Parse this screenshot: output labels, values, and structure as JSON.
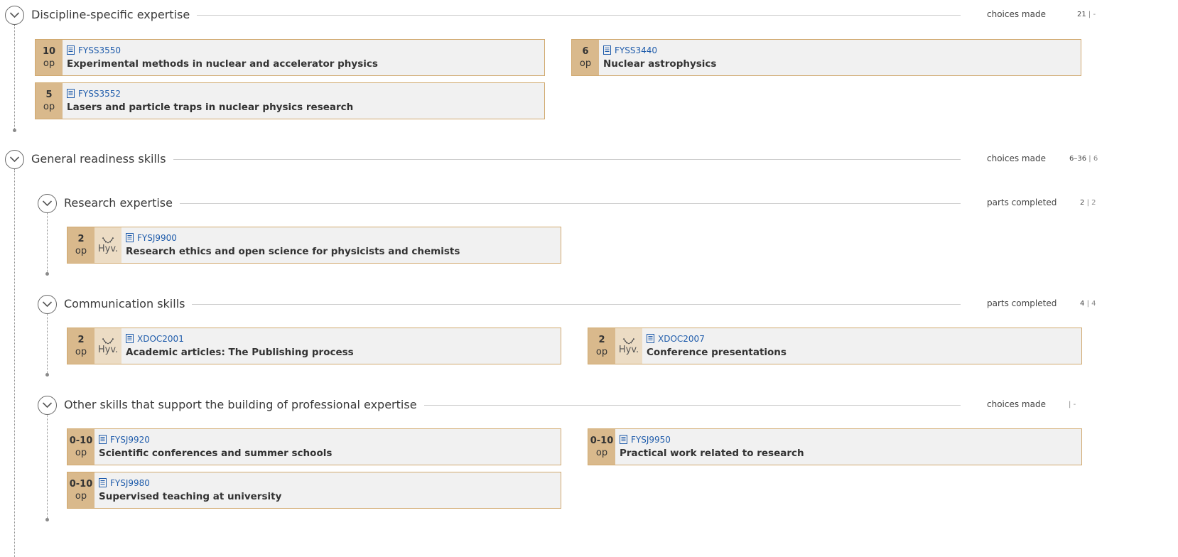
{
  "sections": {
    "discipline": {
      "title": "Discipline-specific expertise",
      "status": "choices made",
      "count": "21",
      "limit": "-"
    },
    "general": {
      "title": "General readiness skills",
      "status": "choices made",
      "count": "6–36",
      "limit": "6"
    },
    "research": {
      "title": "Research expertise",
      "status": "parts completed",
      "count": "2",
      "limit": "2"
    },
    "communication": {
      "title": "Communication skills",
      "status": "parts completed",
      "count": "4",
      "limit": "4"
    },
    "other": {
      "title": "Other skills that support the building of professional expertise",
      "status": "choices made",
      "count": "",
      "limit": "-"
    }
  },
  "courses": {
    "fyss3550": {
      "credits": "10",
      "unit": "op",
      "code": "FYSS3550",
      "name": "Experimental methods in nuclear and accelerator physics"
    },
    "fyss3440": {
      "credits": "6",
      "unit": "op",
      "code": "FYSS3440",
      "name": "Nuclear astrophysics"
    },
    "fyss3552": {
      "credits": "5",
      "unit": "op",
      "code": "FYSS3552",
      "name": "Lasers and particle traps in nuclear physics research"
    },
    "fysj9900": {
      "credits": "2",
      "unit": "op",
      "grade": "Hyv.",
      "code": "FYSJ9900",
      "name": "Research ethics and open science for physicists and chemists"
    },
    "xdoc2001": {
      "credits": "2",
      "unit": "op",
      "grade": "Hyv.",
      "code": "XDOC2001",
      "name": "Academic articles: The Publishing process"
    },
    "xdoc2007": {
      "credits": "2",
      "unit": "op",
      "grade": "Hyv.",
      "code": "XDOC2007",
      "name": "Conference presentations"
    },
    "fysj9920": {
      "credits": "0-10",
      "unit": "op",
      "code": "FYSJ9920",
      "name": "Scientific conferences and summer schools"
    },
    "fysj9950": {
      "credits": "0-10",
      "unit": "op",
      "code": "FYSJ9950",
      "name": "Practical work related to research"
    },
    "fysj9980": {
      "credits": "0-10",
      "unit": "op",
      "code": "FYSJ9980",
      "name": "Supervised teaching at university"
    }
  },
  "icons": {
    "toggle": "chevron-down-icon",
    "course": "document-icon",
    "grade": "laurel-icon"
  },
  "colors": {
    "card_border": "#d1a96f",
    "credits_bg": "#d9b98c",
    "grade_bg": "#ecdcc4",
    "card_bg": "#f1f1f1",
    "link": "#1f5cab"
  }
}
